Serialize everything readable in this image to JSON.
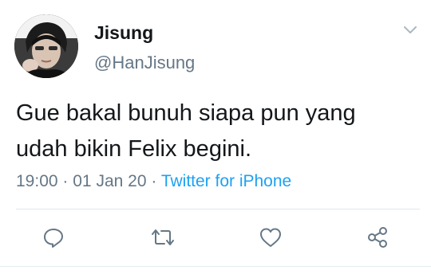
{
  "tweet": {
    "author_name": "Jisung",
    "author_handle": "@HanJisung",
    "text_lines": [
      "Gue bakal bunuh siapa pun yang",
      "udah bikin Felix begini."
    ],
    "time": "19:00",
    "separator": "·",
    "date": "01 Jan 20",
    "source": "Twitter for iPhone"
  },
  "icons": {
    "caret": "chevron-down-icon",
    "reply": "reply-icon",
    "retweet": "retweet-icon",
    "like": "heart-icon",
    "share": "share-icon"
  },
  "colors": {
    "text": "#14171a",
    "secondary": "#657786",
    "link": "#1da1f2",
    "icon": "#657786",
    "divider": "#e1e8ed"
  }
}
